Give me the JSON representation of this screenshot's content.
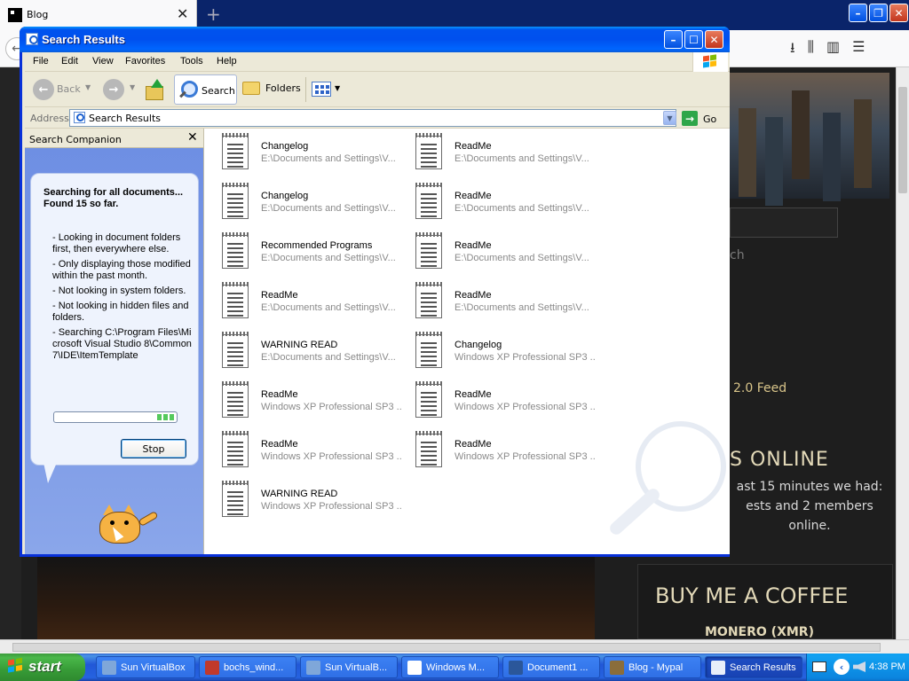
{
  "firefox": {
    "tab_title": "Blog",
    "tab_close": "✕",
    "new_tab": "+",
    "toolbar_icons": [
      "download-icon",
      "library-icon",
      "sidebar-icon",
      "menu-icon"
    ],
    "page": {
      "search_text": "ch",
      "feed_text": "2.0 Feed",
      "online_title": "S ONLINE",
      "online_text": "ast 15 minutes we had: ests and 2 members online.",
      "coffee_title": "BUY ME A COFFEE",
      "monero": "MONERO (XMR)"
    }
  },
  "window": {
    "title": "Search Results",
    "menu": [
      "File",
      "Edit",
      "View",
      "Favorites",
      "Tools",
      "Help"
    ],
    "toolbar": {
      "back": "Back",
      "search": "Search",
      "folders": "Folders"
    },
    "address": {
      "label": "Address",
      "value": "Search Results",
      "go": "Go"
    },
    "companion": {
      "title": "Search Companion",
      "heading": "Searching for all documents... Found 15 so far.",
      "notes": [
        "- Looking in document folders first, then everywhere else.",
        "- Only displaying those modified within the past month.",
        "- Not looking in system folders.",
        "- Not looking in hidden files and folders.",
        "- Searching C:\\Program Files\\Microsoft Visual Studio 8\\Common7\\IDE\\ItemTemplate"
      ],
      "stop": "Stop"
    },
    "results": [
      {
        "name": "Changelog",
        "path": "E:\\Documents and Settings\\V..."
      },
      {
        "name": "ReadMe",
        "path": "E:\\Documents and Settings\\V..."
      },
      {
        "name": "Changelog",
        "path": "E:\\Documents and Settings\\V..."
      },
      {
        "name": "ReadMe",
        "path": "E:\\Documents and Settings\\V..."
      },
      {
        "name": "Recommended Programs",
        "path": "E:\\Documents and Settings\\V..."
      },
      {
        "name": "ReadMe",
        "path": "E:\\Documents and Settings\\V..."
      },
      {
        "name": "ReadMe",
        "path": "E:\\Documents and Settings\\V..."
      },
      {
        "name": "ReadMe",
        "path": "E:\\Documents and Settings\\V..."
      },
      {
        "name": "WARNING READ",
        "path": "E:\\Documents and Settings\\V..."
      },
      {
        "name": "Changelog",
        "path": "Windows XP Professional SP3 ..."
      },
      {
        "name": "ReadMe",
        "path": "Windows XP Professional SP3 ..."
      },
      {
        "name": "ReadMe",
        "path": "Windows XP Professional SP3 ..."
      },
      {
        "name": "ReadMe",
        "path": "Windows XP Professional SP3 ..."
      },
      {
        "name": "ReadMe",
        "path": "Windows XP Professional SP3 ..."
      },
      {
        "name": "WARNING READ",
        "path": "Windows XP Professional SP3 ..."
      }
    ]
  },
  "taskbar": {
    "start": "start",
    "tasks": [
      {
        "label": "Sun VirtualBox",
        "color": "#7fa7d9"
      },
      {
        "label": "bochs_wind...",
        "color": "#c0392b"
      },
      {
        "label": "Sun VirtualB...",
        "color": "#7fa7d9"
      },
      {
        "label": "Windows M...",
        "color": "#ffffff"
      },
      {
        "label": "Document1 ...",
        "color": "#2b579a"
      },
      {
        "label": "Blog - Mypal",
        "color": "#8a6d3b"
      },
      {
        "label": "Search Results",
        "color": "#e8eef9"
      }
    ],
    "clock": "4:38 PM"
  }
}
